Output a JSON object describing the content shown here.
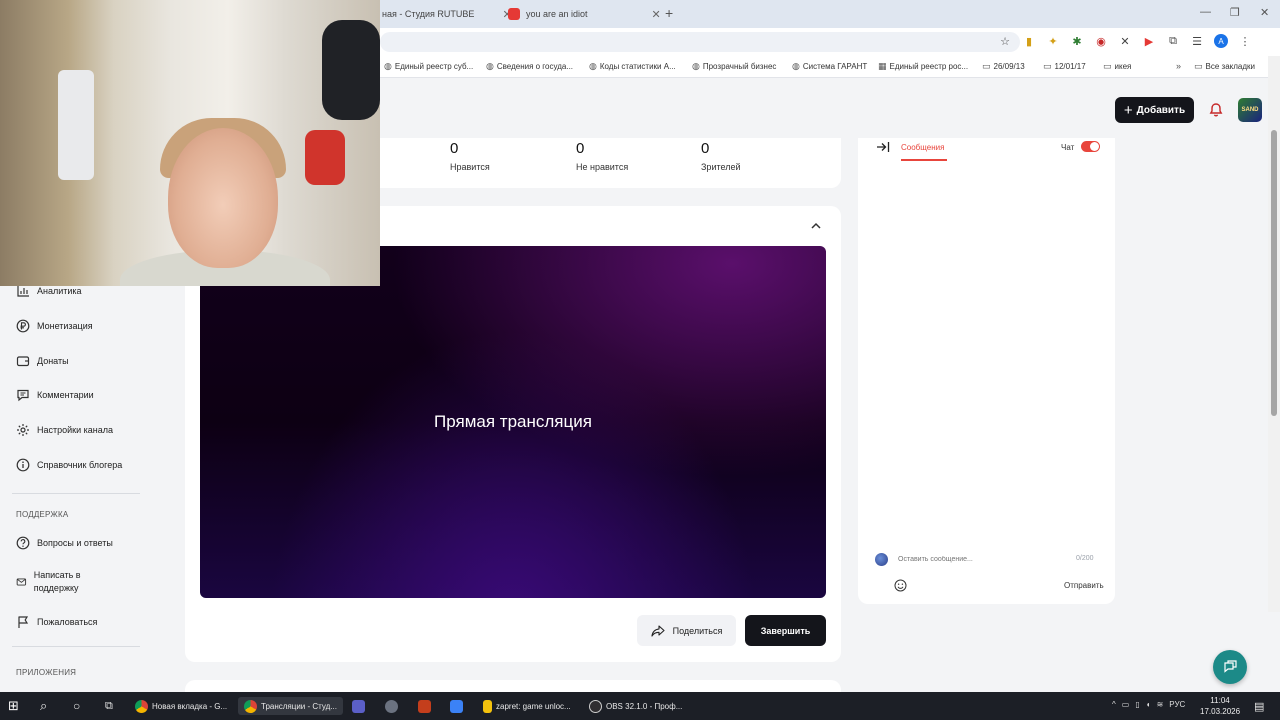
{
  "browser": {
    "tabs": [
      {
        "title": "ная - Студия RUTUBE"
      },
      {
        "title": "you are an idiot"
      }
    ],
    "bookmarks": [
      "Единый реестр суб...",
      "Сведения о госуда...",
      "Коды статистики А...",
      "Прозрачный бизнес",
      "Система ГАРАНТ",
      "Единый реестр рос...",
      "26/09/13",
      "12/01/17",
      "икея"
    ],
    "bookmarks_all": "Все закладки",
    "profile_letter": "А"
  },
  "header": {
    "add_label": "Добавить",
    "avatar_text": "SAND"
  },
  "stats": [
    {
      "value": "0",
      "label": "Нравится"
    },
    {
      "value": "0",
      "label": "Не нравится"
    },
    {
      "value": "0",
      "label": "Зрителей"
    }
  ],
  "player": {
    "title": "Прямая трансляция"
  },
  "actions": {
    "share_label": "Поделиться",
    "finish_label": "Завершить"
  },
  "chat": {
    "tab_label": "Сообщения",
    "toggle_label": "Чат",
    "toggle_on": true,
    "input_placeholder": "Оставить сообщение...",
    "char_count": "0/200",
    "send_label": "Отправить"
  },
  "sidebar": {
    "items_top": [
      {
        "label": "Аналитика",
        "icon": "analytics-icon"
      },
      {
        "label": "Монетизация",
        "icon": "ruble-icon"
      },
      {
        "label": "Донаты",
        "icon": "wallet-icon"
      },
      {
        "label": "Комментарии",
        "icon": "comment-icon"
      },
      {
        "label": "Настройки канала",
        "icon": "gear-icon"
      },
      {
        "label": "Справочник блогера",
        "icon": "info-icon"
      }
    ],
    "support_heading": "ПОДДЕРЖКА",
    "items_support": [
      {
        "label": "Вопросы и ответы",
        "icon": "question-icon"
      },
      {
        "label": "Написать в поддержку",
        "icon": "mail-icon"
      },
      {
        "label": "Пожаловаться",
        "icon": "flag-icon"
      }
    ],
    "apps_heading": "ПРИЛОЖЕНИЯ"
  },
  "taskbar": {
    "items": [
      {
        "label": "Новая вкладка - G..."
      },
      {
        "label": "Трансляции - Студ..."
      },
      {
        "label": "zapret: game unloc..."
      },
      {
        "label": "OBS 32.1.0 - Проф..."
      }
    ],
    "lang": "РУС",
    "time": "11:04",
    "date": "17.03.2026"
  },
  "colors": {
    "accent_red": "#e8453c",
    "dark_button": "#14151b",
    "help_fab": "#1c8a88"
  }
}
